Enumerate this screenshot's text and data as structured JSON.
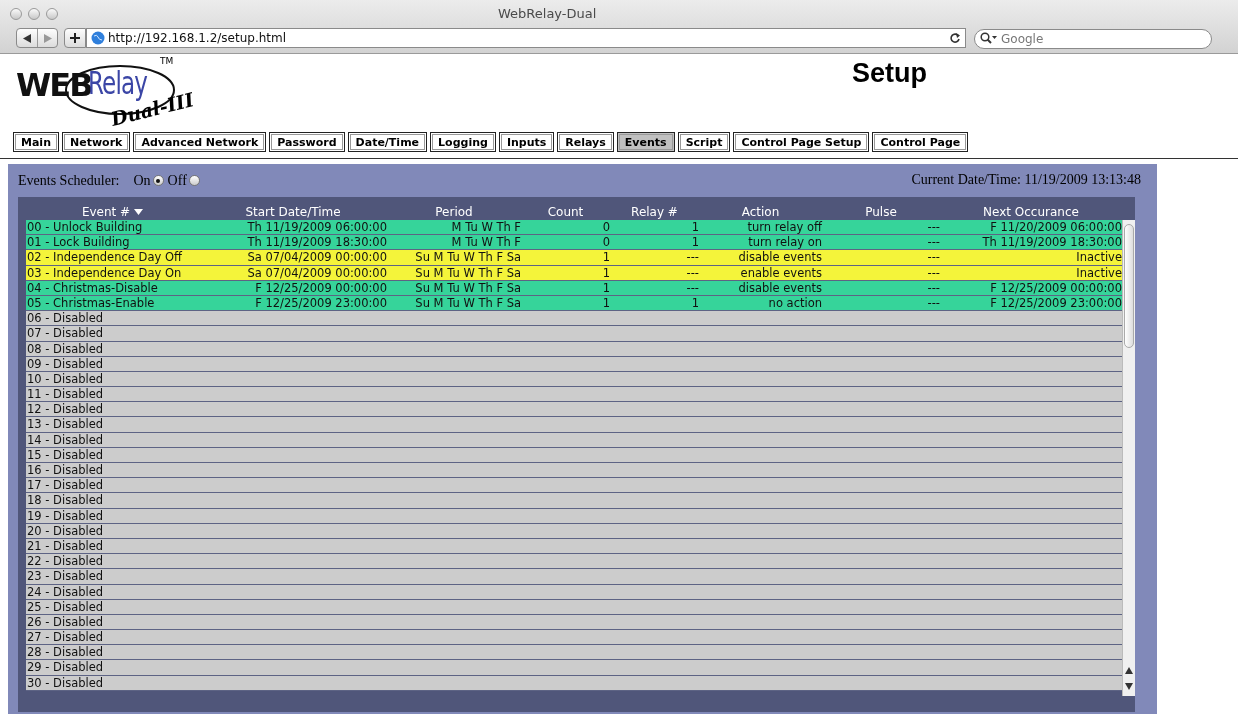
{
  "window": {
    "title": "WebRelay-Dual"
  },
  "toolbar": {
    "url": "http://192.168.1.2/setup.html",
    "search": {
      "placeholder": "Google"
    }
  },
  "logo": {
    "web": "WEB",
    "relay": "Relay",
    "tm": "TM",
    "model": "Dual-III"
  },
  "page_title": "Setup",
  "tabs": [
    {
      "label": "Main",
      "selected": false
    },
    {
      "label": "Network",
      "selected": false
    },
    {
      "label": "Advanced Network",
      "selected": false
    },
    {
      "label": "Password",
      "selected": false
    },
    {
      "label": "Date/Time",
      "selected": false
    },
    {
      "label": "Logging",
      "selected": false
    },
    {
      "label": "Inputs",
      "selected": false
    },
    {
      "label": "Relays",
      "selected": false
    },
    {
      "label": "Events",
      "selected": true
    },
    {
      "label": "Script",
      "selected": false
    },
    {
      "label": "Control Page Setup",
      "selected": false
    },
    {
      "label": "Control Page",
      "selected": false
    }
  ],
  "scheduler": {
    "label": "Events Scheduler:",
    "options": [
      {
        "label": "On",
        "selected": true
      },
      {
        "label": "Off",
        "selected": false
      }
    ]
  },
  "current_datetime": "Current Date/Time: 11/19/2009 13:13:48",
  "table": {
    "columns": [
      "Event #",
      "Start Date/Time",
      "Period",
      "Count",
      "Relay #",
      "Action",
      "Pulse",
      "Next Occurance"
    ],
    "rows": [
      {
        "color": "#36d49a",
        "cells": [
          "00 - Unlock Building",
          "Th 11/19/2009 06:00:00",
          "M Tu W Th F",
          "0",
          "1",
          "turn relay off",
          "---",
          "F 11/20/2009 06:00:00"
        ]
      },
      {
        "color": "#36d49a",
        "cells": [
          "01 - Lock Building",
          "Th 11/19/2009 18:30:00",
          "M Tu W Th F",
          "0",
          "1",
          "turn relay on",
          "---",
          "Th 11/19/2009 18:30:00"
        ]
      },
      {
        "color": "#f4f43a",
        "cells": [
          "02 - Independence Day Off",
          "Sa 07/04/2009 00:00:00",
          "Su M Tu W Th F Sa",
          "1",
          "---",
          "disable events",
          "---",
          "Inactive"
        ]
      },
      {
        "color": "#f4f43a",
        "cells": [
          "03 - Independence Day On",
          "Sa 07/04/2009 00:00:00",
          "Su M Tu W Th F Sa",
          "1",
          "---",
          "enable events",
          "---",
          "Inactive"
        ]
      },
      {
        "color": "#36d49a",
        "cells": [
          "04 - Christmas-Disable",
          "F 12/25/2009 00:00:00",
          "Su M Tu W Th F Sa",
          "1",
          "---",
          "disable events",
          "---",
          "F 12/25/2009 00:00:00"
        ]
      },
      {
        "color": "#36d49a",
        "cells": [
          "05 - Christmas-Enable",
          "F 12/25/2009 23:00:00",
          "Su M Tu W Th F Sa",
          "1",
          "1",
          "no action",
          "---",
          "F 12/25/2009 23:00:00"
        ]
      },
      {
        "color": "#cccccc",
        "cells": [
          "06 - Disabled"
        ]
      },
      {
        "color": "#cccccc",
        "cells": [
          "07 - Disabled"
        ]
      },
      {
        "color": "#cccccc",
        "cells": [
          "08 - Disabled"
        ]
      },
      {
        "color": "#cccccc",
        "cells": [
          "09 - Disabled"
        ]
      },
      {
        "color": "#cccccc",
        "cells": [
          "10 - Disabled"
        ]
      },
      {
        "color": "#cccccc",
        "cells": [
          "11 - Disabled"
        ]
      },
      {
        "color": "#cccccc",
        "cells": [
          "12 - Disabled"
        ]
      },
      {
        "color": "#cccccc",
        "cells": [
          "13 - Disabled"
        ]
      },
      {
        "color": "#cccccc",
        "cells": [
          "14 - Disabled"
        ]
      },
      {
        "color": "#cccccc",
        "cells": [
          "15 - Disabled"
        ]
      },
      {
        "color": "#cccccc",
        "cells": [
          "16 - Disabled"
        ]
      },
      {
        "color": "#cccccc",
        "cells": [
          "17 - Disabled"
        ]
      },
      {
        "color": "#cccccc",
        "cells": [
          "18 - Disabled"
        ]
      },
      {
        "color": "#cccccc",
        "cells": [
          "19 - Disabled"
        ]
      },
      {
        "color": "#cccccc",
        "cells": [
          "20 - Disabled"
        ]
      },
      {
        "color": "#cccccc",
        "cells": [
          "21 - Disabled"
        ]
      },
      {
        "color": "#cccccc",
        "cells": [
          "22 - Disabled"
        ]
      },
      {
        "color": "#cccccc",
        "cells": [
          "23 - Disabled"
        ]
      },
      {
        "color": "#cccccc",
        "cells": [
          "24 - Disabled"
        ]
      },
      {
        "color": "#cccccc",
        "cells": [
          "25 - Disabled"
        ]
      },
      {
        "color": "#cccccc",
        "cells": [
          "26 - Disabled"
        ]
      },
      {
        "color": "#cccccc",
        "cells": [
          "27 - Disabled"
        ]
      },
      {
        "color": "#cccccc",
        "cells": [
          "28 - Disabled"
        ]
      },
      {
        "color": "#cccccc",
        "cells": [
          "29 - Disabled"
        ]
      },
      {
        "color": "#cccccc",
        "cells": [
          "30 - Disabled"
        ]
      }
    ]
  }
}
